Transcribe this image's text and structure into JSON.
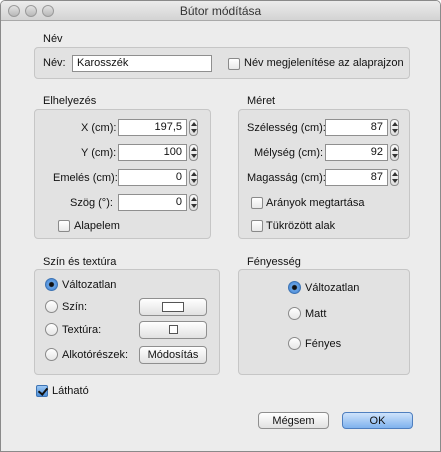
{
  "window": {
    "title": "Bútor módítása"
  },
  "nev_group": {
    "title": "Név",
    "name_label": "Név:",
    "name_value": "Karosszék",
    "show_name_label": "Név megjelenítése az alaprajzon",
    "show_name_checked": false
  },
  "elhelyezes": {
    "title": "Elhelyezés",
    "x_label": "X (cm):",
    "x_value": "197,5",
    "y_label": "Y (cm):",
    "y_value": "100",
    "elev_label": "Emelés (cm):",
    "elev_value": "0",
    "angle_label": "Szög (°):",
    "angle_value": "0",
    "base_label": "Alapelem",
    "base_checked": false
  },
  "meret": {
    "title": "Méret",
    "width_label": "Szélesség (cm):",
    "width_value": "87",
    "depth_label": "Mélység (cm):",
    "depth_value": "92",
    "height_label": "Magasság (cm):",
    "height_value": "87",
    "keep_ratio_label": "Arányok megtartása",
    "keep_ratio_checked": false,
    "mirror_label": "Tükrözött alak",
    "mirror_checked": false
  },
  "szin": {
    "title": "Szín és textúra",
    "unchanged_label": "Változatlan",
    "color_label": "Szín:",
    "texture_label": "Textúra:",
    "parts_label": "Alkotórészek:",
    "modify_button": "Módosítás",
    "selected": "unchanged"
  },
  "fenyesseg": {
    "title": "Fényesség",
    "unchanged_label": "Változatlan",
    "matte_label": "Matt",
    "glossy_label": "Fényes",
    "selected": "unchanged"
  },
  "visible": {
    "label": "Látható",
    "checked": true
  },
  "buttons": {
    "cancel": "Mégsem",
    "ok": "OK"
  },
  "colors": {
    "default_button": "#7fb2ee",
    "group_bg": "#e2e2e2",
    "window_bg": "#ececec"
  }
}
